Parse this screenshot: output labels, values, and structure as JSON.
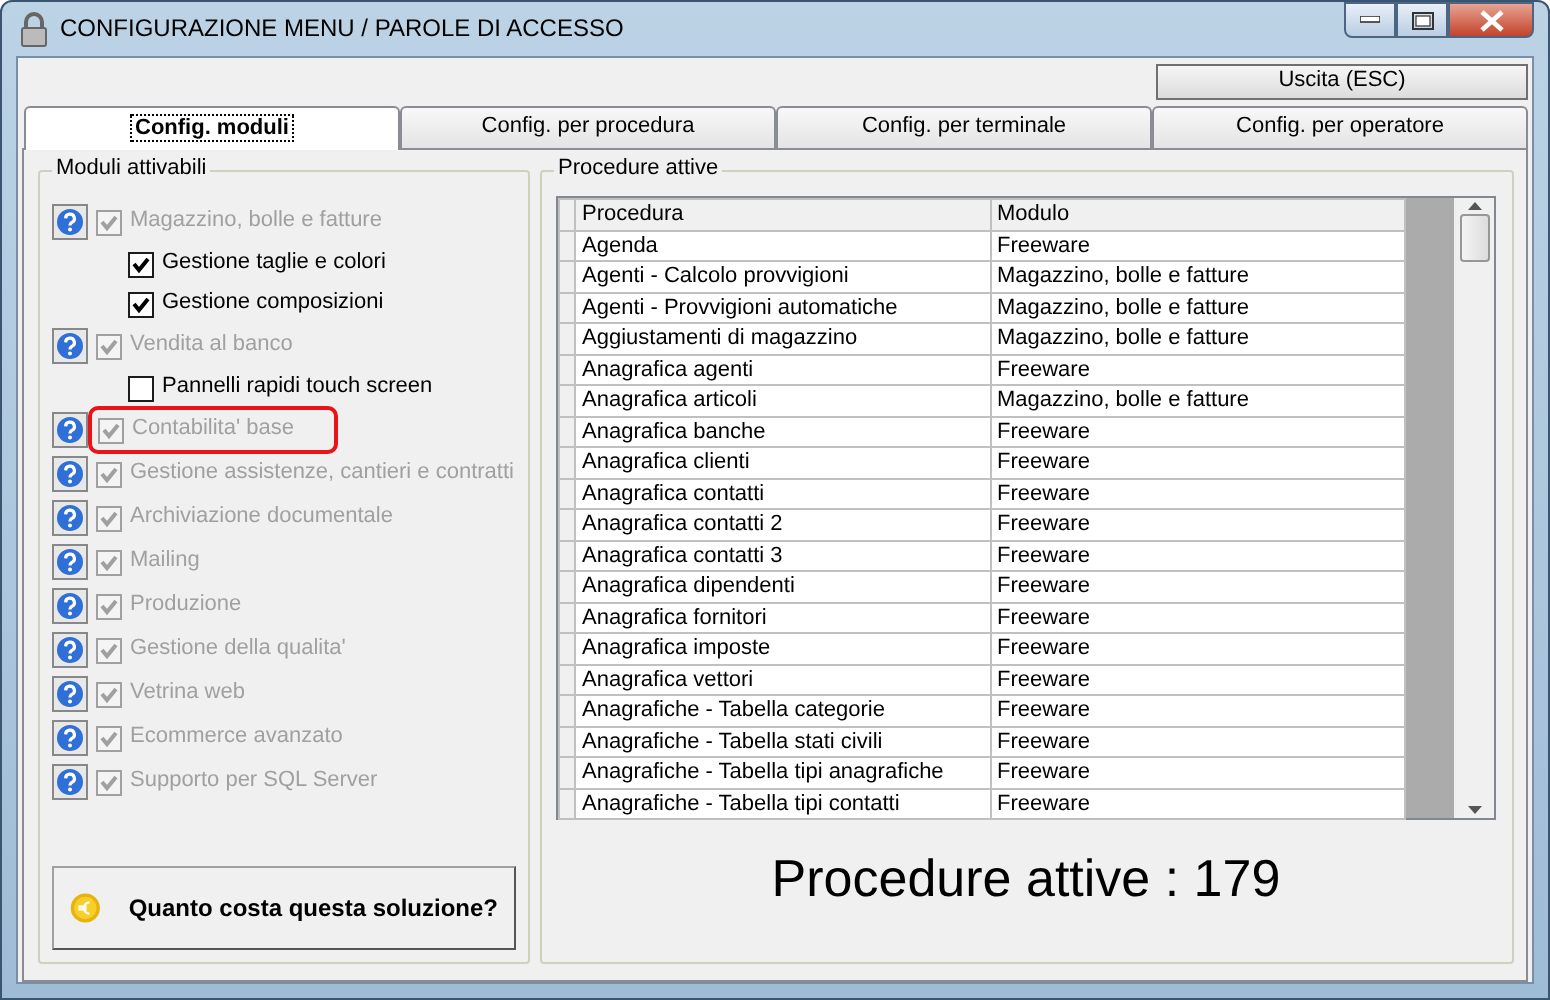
{
  "window": {
    "title": "CONFIGURAZIONE MENU / PAROLE DI ACCESSO"
  },
  "exit_button": "Uscita (ESC)",
  "tabs": [
    {
      "label": "Config. moduli",
      "selected": true
    },
    {
      "label": "Config. per procedura",
      "selected": false
    },
    {
      "label": "Config. per terminale",
      "selected": false
    },
    {
      "label": "Config. per operatore",
      "selected": false
    }
  ],
  "modules_group": {
    "title": "Moduli attivabili",
    "items": [
      {
        "kind": "module",
        "label": "Magazzino, bolle e fatture",
        "checked": true,
        "enabled": false,
        "highlighted": false
      },
      {
        "kind": "option",
        "label": "Gestione taglie e colori",
        "checked": true,
        "enabled": true,
        "highlighted": false
      },
      {
        "kind": "option",
        "label": "Gestione composizioni",
        "checked": true,
        "enabled": true,
        "highlighted": false
      },
      {
        "kind": "module",
        "label": "Vendita al banco",
        "checked": true,
        "enabled": false,
        "highlighted": false
      },
      {
        "kind": "option",
        "label": "Pannelli rapidi touch screen",
        "checked": false,
        "enabled": true,
        "highlighted": false
      },
      {
        "kind": "module",
        "label": "Contabilita' base",
        "checked": true,
        "enabled": false,
        "highlighted": true
      },
      {
        "kind": "module",
        "label": "Gestione assistenze, cantieri e contratti",
        "checked": true,
        "enabled": false,
        "highlighted": false
      },
      {
        "kind": "module",
        "label": "Archiviazione documentale",
        "checked": true,
        "enabled": false,
        "highlighted": false
      },
      {
        "kind": "module",
        "label": "Mailing",
        "checked": true,
        "enabled": false,
        "highlighted": false
      },
      {
        "kind": "module",
        "label": "Produzione",
        "checked": true,
        "enabled": false,
        "highlighted": false
      },
      {
        "kind": "module",
        "label": "Gestione della qualita'",
        "checked": true,
        "enabled": false,
        "highlighted": false
      },
      {
        "kind": "module",
        "label": "Vetrina web",
        "checked": true,
        "enabled": false,
        "highlighted": false
      },
      {
        "kind": "module",
        "label": "Ecommerce avanzato",
        "checked": true,
        "enabled": false,
        "highlighted": false
      },
      {
        "kind": "module",
        "label": "Supporto per SQL Server",
        "checked": true,
        "enabled": false,
        "highlighted": false
      }
    ]
  },
  "price_button": "Quanto costa questa soluzione?",
  "procedures_group": {
    "title": "Procedure attive",
    "table": {
      "columns": [
        "Procedura",
        "Modulo"
      ],
      "rows": [
        [
          "Agenda",
          "Freeware"
        ],
        [
          "Agenti - Calcolo provvigioni",
          "Magazzino, bolle e fatture"
        ],
        [
          "Agenti - Provvigioni automatiche",
          "Magazzino, bolle e fatture"
        ],
        [
          "Aggiustamenti di magazzino",
          "Magazzino, bolle e fatture"
        ],
        [
          "Anagrafica agenti",
          "Freeware"
        ],
        [
          "Anagrafica articoli",
          "Magazzino, bolle e fatture"
        ],
        [
          "Anagrafica banche",
          "Freeware"
        ],
        [
          "Anagrafica clienti",
          "Freeware"
        ],
        [
          "Anagrafica contatti",
          "Freeware"
        ],
        [
          "Anagrafica contatti 2",
          "Freeware"
        ],
        [
          "Anagrafica contatti 3",
          "Freeware"
        ],
        [
          "Anagrafica dipendenti",
          "Freeware"
        ],
        [
          "Anagrafica fornitori",
          "Freeware"
        ],
        [
          "Anagrafica imposte",
          "Freeware"
        ],
        [
          "Anagrafica vettori",
          "Freeware"
        ],
        [
          "Anagrafiche - Tabella categorie",
          "Freeware"
        ],
        [
          "Anagrafiche - Tabella stati civili",
          "Freeware"
        ],
        [
          "Anagrafiche - Tabella tipi anagrafiche",
          "Freeware"
        ],
        [
          "Anagrafiche - Tabella tipi contatti",
          "Freeware"
        ]
      ]
    },
    "summary": "Procedure attive : 179"
  }
}
